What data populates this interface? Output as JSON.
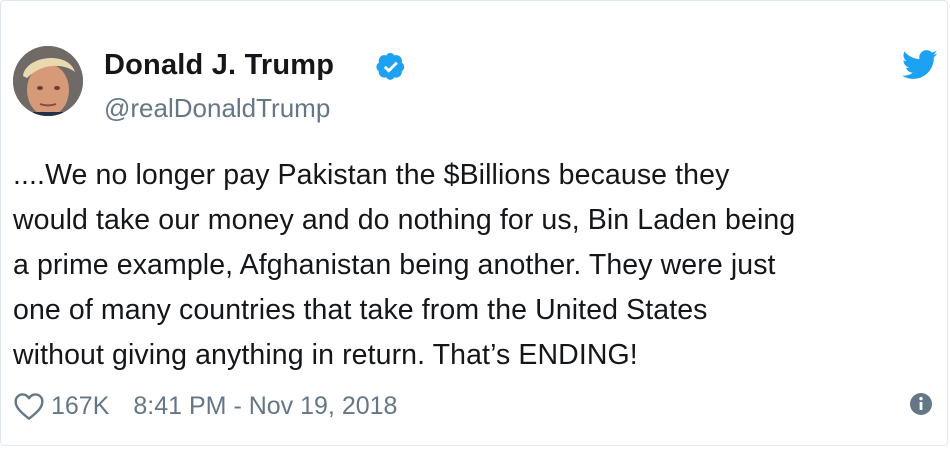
{
  "tweet": {
    "display_name": "Donald J. Trump",
    "handle": "@realDonaldTrump",
    "text": "....We no longer pay Pakistan the $Billions because they\nwould take our money and do nothing for us, Bin Laden being\na prime example, Afghanistan being another. They were just\none of many countries that take from the United States\nwithout giving anything in return. That’s ENDING!",
    "likes": "167K",
    "timestamp": "8:41 PM - Nov 19, 2018"
  },
  "icons": {
    "verified": "verified-badge-icon",
    "bird": "twitter-bird-icon",
    "heart": "heart-icon",
    "info": "info-icon"
  },
  "colors": {
    "twitter_blue": "#1da1f2",
    "text": "#14171a",
    "muted": "#657786",
    "border": "#e1e8ed"
  }
}
